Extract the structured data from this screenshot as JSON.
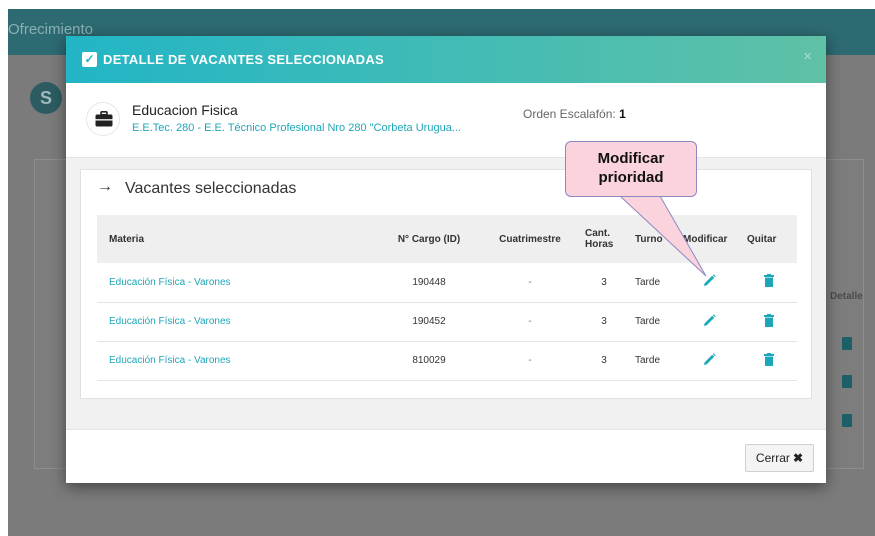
{
  "background": {
    "header_title": "Ofrecimiento",
    "avatar_initial": "S",
    "detalle_label": "Detalle"
  },
  "modal": {
    "title": "DETALLE DE VACANTES SELECCIONADAS",
    "close_symbol": "×",
    "subject_name": "Educacion Fisica",
    "school": "E.E.Tec. 280 - E.E. Técnico Profesional Nro 280 \"Corbeta Urugua...",
    "orden_label": "Orden Escalafón:",
    "orden_value": "1",
    "section_arrow": "→",
    "section_title": "Vacantes seleccionadas",
    "columns": {
      "materia": "Materia",
      "cargo": "N° Cargo (ID)",
      "cuatrimestre": "Cuatrimestre",
      "horas": "Cant. Horas",
      "turno": "Turno",
      "modificar": "Modificar",
      "quitar": "Quitar"
    },
    "rows": [
      {
        "materia": "Educación Física - Varones",
        "cargo": "190448",
        "cuatrimestre": "-",
        "horas": "3",
        "turno": "Tarde"
      },
      {
        "materia": "Educación Física - Varones",
        "cargo": "190452",
        "cuatrimestre": "-",
        "horas": "3",
        "turno": "Tarde"
      },
      {
        "materia": "Educación Física - Varones",
        "cargo": "810029",
        "cuatrimestre": "-",
        "horas": "3",
        "turno": "Tarde"
      }
    ],
    "close_button": "Cerrar",
    "close_button_icon": "✖"
  },
  "callout": {
    "text": "Modificar\nprioridad"
  },
  "icons": {
    "header_check": "check-icon",
    "info": "briefcase-icon",
    "modify": "pencil-icon",
    "remove": "trash-icon",
    "background_rows": "document-icon"
  },
  "colors": {
    "accent": "#21a6b7",
    "header_gradient_start": "#22b5c6",
    "header_gradient_end": "#5fc1a6",
    "callout_fill": "#fad3dd"
  }
}
